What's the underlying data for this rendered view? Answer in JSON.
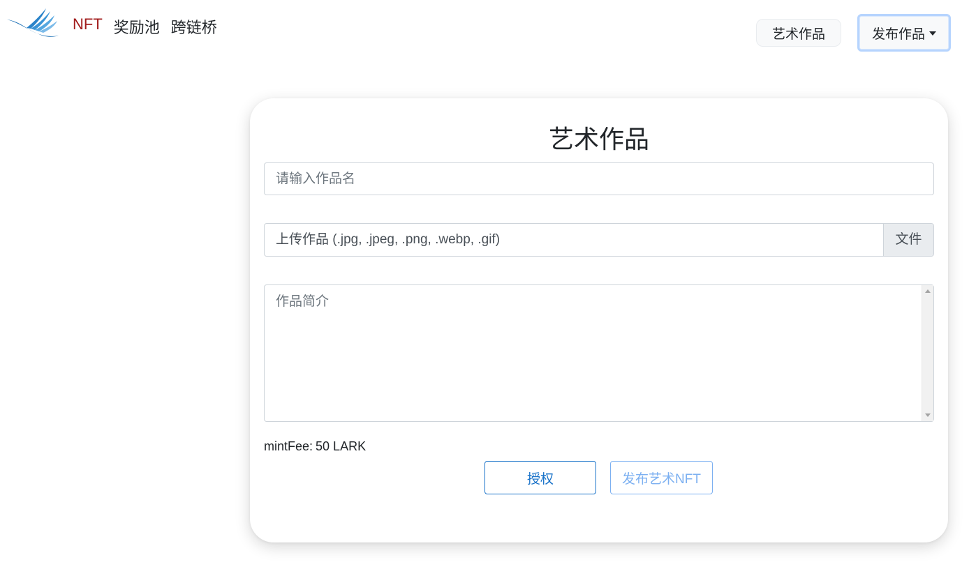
{
  "header": {
    "nav": [
      {
        "label": "NFT",
        "active": true
      },
      {
        "label": "奖励池",
        "active": false
      },
      {
        "label": "跨链桥",
        "active": false
      }
    ],
    "art_button": "艺术作品",
    "publish_dropdown": "发布作品"
  },
  "form": {
    "title": "艺术作品",
    "name_placeholder": "请输入作品名",
    "file_label": "上传作品 (.jpg, .jpeg, .png, .webp, .gif)",
    "file_button": "文件",
    "description_placeholder": "作品简介",
    "mint_fee_label": "mintFee:",
    "mint_fee_value": "50 LARK",
    "approve_button": "授权",
    "publish_button": "发布艺术NFT"
  },
  "colors": {
    "active_nav": "#a11b1b",
    "primary": "#1a73c9",
    "primary_light": "#6ea8f0",
    "logo": "#1a6fb5"
  },
  "icons": [
    "bird-wing-logo",
    "caret-down-icon",
    "scroll-up-icon",
    "scroll-down-icon"
  ]
}
